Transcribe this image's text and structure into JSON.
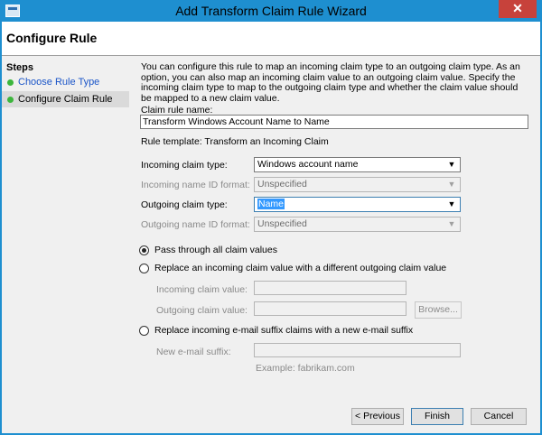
{
  "window": {
    "title": "Add Transform Claim Rule Wizard",
    "close_glyph": "✕",
    "icons": {
      "app": "wizard-app-icon",
      "close": "close-icon"
    }
  },
  "header": {
    "title": "Configure Rule"
  },
  "steps": {
    "title": "Steps",
    "items": [
      {
        "label": "Choose Rule Type",
        "state": "completed-link"
      },
      {
        "label": "Configure Claim Rule",
        "state": "current"
      }
    ]
  },
  "main": {
    "description": "You can configure this rule to map an incoming claim type to an outgoing claim type. As an option, you can also map an incoming claim value to an outgoing claim value. Specify the incoming claim type to map to the outgoing claim type and whether the claim value should be mapped to a new claim value.",
    "claim_rule_name_label": "Claim rule name:",
    "claim_rule_name_value": "Transform Windows Account Name to Name",
    "rule_template_text": "Rule template: Transform an Incoming Claim",
    "incoming_claim_type_label": "Incoming claim type:",
    "incoming_claim_type_value": "Windows account name",
    "incoming_name_id_format_label": "Incoming name ID format:",
    "incoming_name_id_format_value": "Unspecified",
    "outgoing_claim_type_label": "Outgoing claim type:",
    "outgoing_claim_type_value": "Name",
    "outgoing_name_id_format_label": "Outgoing name ID format:",
    "outgoing_name_id_format_value": "Unspecified",
    "radio_pass_through": "Pass through all claim values",
    "radio_replace_value": "Replace an incoming claim value with a different outgoing claim value",
    "incoming_claim_value_label": "Incoming claim value:",
    "outgoing_claim_value_label": "Outgoing claim value:",
    "browse_label": "Browse...",
    "radio_replace_suffix": "Replace incoming e-mail suffix claims with a new e-mail suffix",
    "new_email_suffix_label": "New e-mail suffix:",
    "example_text": "Example: fabrikam.com",
    "selected_option": "pass-through"
  },
  "footer": {
    "previous_label": "< Previous",
    "finish_label": "Finish",
    "cancel_label": "Cancel"
  },
  "combo_arrow": "▼",
  "colors": {
    "titlebar": "#1e8fd0",
    "close": "#c7423b",
    "step_dot": "#3db63d",
    "link": "#1a55c8",
    "selection": "#3399ff"
  }
}
